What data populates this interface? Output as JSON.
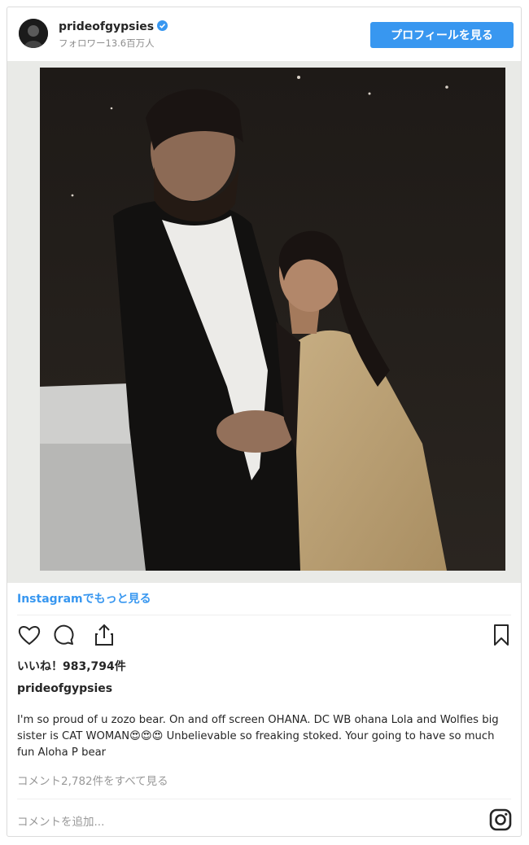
{
  "header": {
    "username": "prideofgypsies",
    "followers": "フォロワー13.6百万人",
    "profile_button": "プロフィールを見る"
  },
  "post": {
    "see_more_link": "Instagramでもっと見る",
    "likes": "いいね！983,794件",
    "author": "prideofgypsies",
    "caption": "I'm so proud of u zozo bear. On and off screen OHANA. DC WB ohana Lola and Wolfies big sister is CAT WOMAN😍😍😍 Unbelievable so freaking stoked. Your going to have so much fun Aloha P bear",
    "view_comments": "コメント2,782件をすべて見る",
    "add_comment_placeholder": "コメントを追加..."
  },
  "icons": {
    "like": "heart-icon",
    "comment": "comment-icon",
    "share": "share-icon",
    "save": "bookmark-icon",
    "instagram": "instagram-icon"
  },
  "colors": {
    "accent": "#3897f0",
    "text": "#262626",
    "muted": "#999999",
    "border": "#dbdbdb"
  }
}
